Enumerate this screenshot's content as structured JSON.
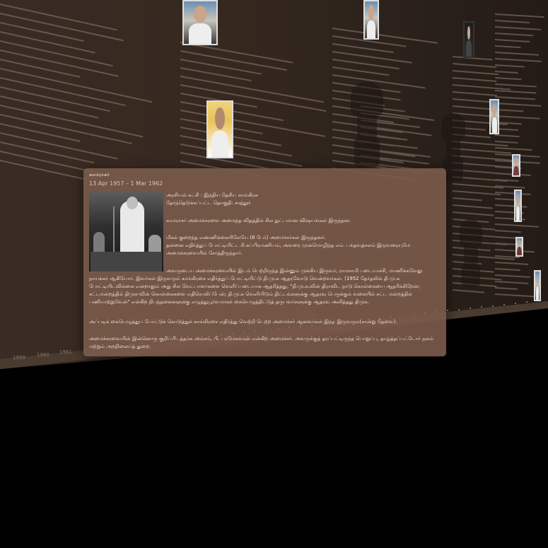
{
  "card": {
    "title": "காமராசர்",
    "dates": "13 Apr 1957 – 1 Mar 1962",
    "party": "அரசியல் கட்சி : இந்திய தேசிய காங்கிரசு",
    "constituency": "தேர்ந்தெடுக்கப்பட்ட தொகுதி: சாத்தூர்",
    "intro": "காமராசர் அமைச்சரவை அமைந்த விதத்தில் சில நுட்பமான விஷயங்கள் இருந்தன:",
    "p1_l1": "மிகக் குறைந்த எண்ணிக்கையிலேயே (8 பேர்) அமைச்சர்கள் இருந்தனர்.",
    "p1_l2": "தன்னை எதிர்த்துப் போட்டியிட்ட சி.சுப்பிரமணியம், அவரை முன்மொழிந்த எம். பக்தவத்சலம் இருவரையுமே",
    "p1_l3": "அமைச்சரவையில் சேர்த்திருந்தார்.",
    "p2_l1": "அவருடைய அமைச்சரவையில் இடம் பெற்றிருந்த இன்னும் முக்கிய இருவர், ராமசாமி படையாச்சி, மாணிக்கவேலு",
    "p2_l2": "நாயக்கர் ஆகியோர். இவர்கள் இருவரும் காங்கிரசை எதிர்த்துப் போட்டியிட்டு தி.மு.க ஆதரவோடு வென்றவர்கள். (1952 தேர்தலில் தி.மு.க",
    "p2_l3": "போட்டியிடவில்லை என்றாலும் அது சில வேட்பாளர்களை வெளிப்படையாக ஆதரித்தது, \"தி.மு.க.வின் திராவிட நாடு கொள்கையை ஆதரிக்கிறேன்;",
    "p2_l4": "சட்டமன்றத்தில் திமுக-வின் கொள்கைகளை எதிரொலிப்பேன்; தி.மு.க வெளியிடும் திட்டங்களுக்கு ஆதரவு பெருக்கும் வகையில் சட்ட மன்றத்தில்",
    "p2_l5": "பணியாற்றுவேன்\" என்கிற நிபந்தனைகளுக்கு எழுத்துபூர்வமாகக் கையெழுத்திட்டுத் தருபவர்களுக்கு ஆதரவு அளித்தது திமுக.",
    "p3": "அப்படிக் கையெழுத்துப் போட்டுக் கொடுத்துக் காங்கிரசை எதிர்த்து வெற்றி பெற்ற அமைச்சர் ஆனவர்கள் இந்த இருவரும்(சான்று தேவை).",
    "p4_l1": "அமைச்சரவையின் இன்னொரு குறிப்பிடத்தக்க அம்சம், பி. பரமேசுவரன் என்கிற அமைச்சர். அவருக்குத் தரப்பட்டிருந்த பொறுப்பு, தாழ்த்தப்பட்டோர் நலம்",
    "p4_l2": "மற்றும் அறநிலையத் துறை."
  },
  "timeline": {
    "years": [
      "1959",
      "1960",
      "1961"
    ]
  },
  "colors": {
    "wall": "#3a2c24",
    "card": "#7a5a4a",
    "background": "#000000"
  },
  "icons": [
    "portrait-photo",
    "state-emblem"
  ]
}
